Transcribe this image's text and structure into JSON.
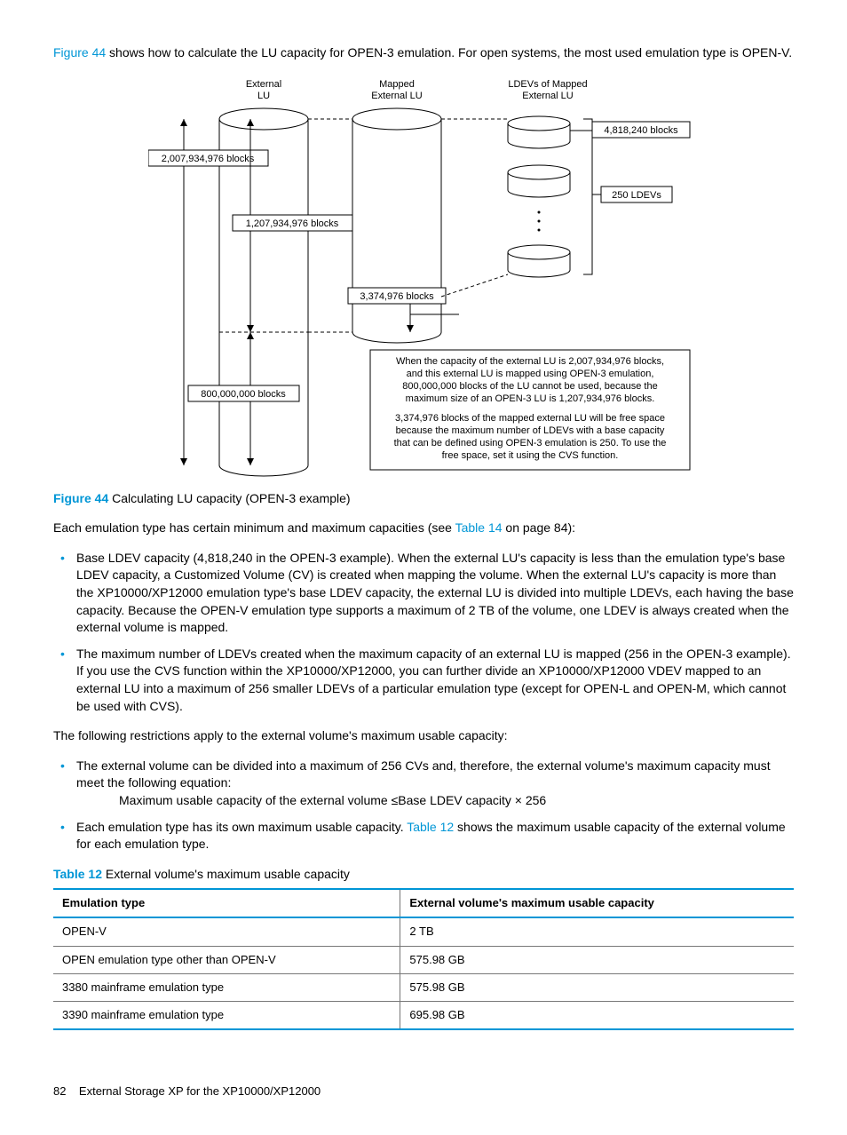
{
  "intro": {
    "figref": "Figure 44",
    "text_after": " shows how to calculate the LU capacity for OPEN-3 emulation. For open systems, the most used emulation type is OPEN-V."
  },
  "diagram": {
    "col1_title_l1": "External",
    "col1_title_l2": "LU",
    "col2_title_l1": "Mapped",
    "col2_title_l2": "External LU",
    "col3_title_l1": "LDEVs of Mapped",
    "col3_title_l2": "External LU",
    "box_2007": "2,007,934,976 blocks",
    "box_1207": "1,207,934,976 blocks",
    "box_3374": "3,374,976 blocks",
    "box_800": "800,000,000 blocks",
    "box_4818": "4,818,240 blocks",
    "box_250": "250 LDEVs",
    "note_l1": "When the capacity of the external LU is 2,007,934,976 blocks,",
    "note_l2": "and this external LU is mapped using OPEN-3 emulation,",
    "note_l3": "800,000,000 blocks of the LU cannot be used, because the",
    "note_l4": "maximum size of an OPEN-3 LU is 1,207,934,976 blocks.",
    "note_l5": "3,374,976 blocks of the mapped external LU will be free space",
    "note_l6": "because the maximum number of LDEVs with a base capacity",
    "note_l7": "that can be defined using OPEN-3 emulation is 250. To use the",
    "note_l8": "free space, set it using the CVS function."
  },
  "fig_caption": {
    "num": "Figure 44",
    "text": "  Calculating LU capacity (OPEN-3 example)"
  },
  "para_each": {
    "before": "Each emulation type has certain minimum and maximum capacities (see ",
    "link": "Table 14",
    "after": " on page 84):"
  },
  "bullets1": [
    "Base LDEV capacity (4,818,240 in the OPEN-3 example). When the external LU's capacity is less than the emulation type's base LDEV capacity, a Customized Volume (CV) is created when mapping the volume. When the external LU's capacity is more than the XP10000/XP12000 emulation type's base LDEV capacity, the external LU is divided into multiple LDEVs, each having the base capacity. Because the OPEN-V emulation type supports a maximum of 2 TB of the volume, one LDEV is always created when the external volume is mapped.",
    "The maximum number of LDEVs created when the maximum capacity of an external LU is mapped (256 in the OPEN-3 example). If you use the CVS function within the XP10000/XP12000, you can further divide an XP10000/XP12000 VDEV mapped to an external LU into a maximum of 256 smaller LDEVs of a particular emulation type (except for OPEN-L and OPEN-M, which cannot be used with CVS)."
  ],
  "para_restrict": "The following restrictions apply to the external volume's maximum usable capacity:",
  "bullets2_a": "The external volume can be divided into a maximum of 256 CVs and, therefore, the external volume's maximum capacity must meet the following equation:",
  "equation": "Maximum usable capacity of the external volume ≤Base LDEV capacity × 256",
  "bullets2_b": {
    "before": "Each emulation type has its own maximum usable capacity. ",
    "link": "Table 12",
    "after": " shows the maximum usable capacity of the external volume for each emulation type."
  },
  "table_caption": {
    "num": "Table 12",
    "text": "   External volume's maximum usable capacity"
  },
  "table": {
    "h1": "Emulation type",
    "h2": "External volume's maximum usable capacity",
    "rows": [
      {
        "c1": "OPEN-V",
        "c2": "2 TB"
      },
      {
        "c1": "OPEN emulation type other than OPEN-V",
        "c2": "575.98 GB"
      },
      {
        "c1": "3380 mainframe emulation type",
        "c2": "575.98 GB"
      },
      {
        "c1": "3390 mainframe emulation type",
        "c2": "695.98 GB"
      }
    ]
  },
  "footer": {
    "page": "82",
    "title": "External Storage XP for the XP10000/XP12000"
  }
}
